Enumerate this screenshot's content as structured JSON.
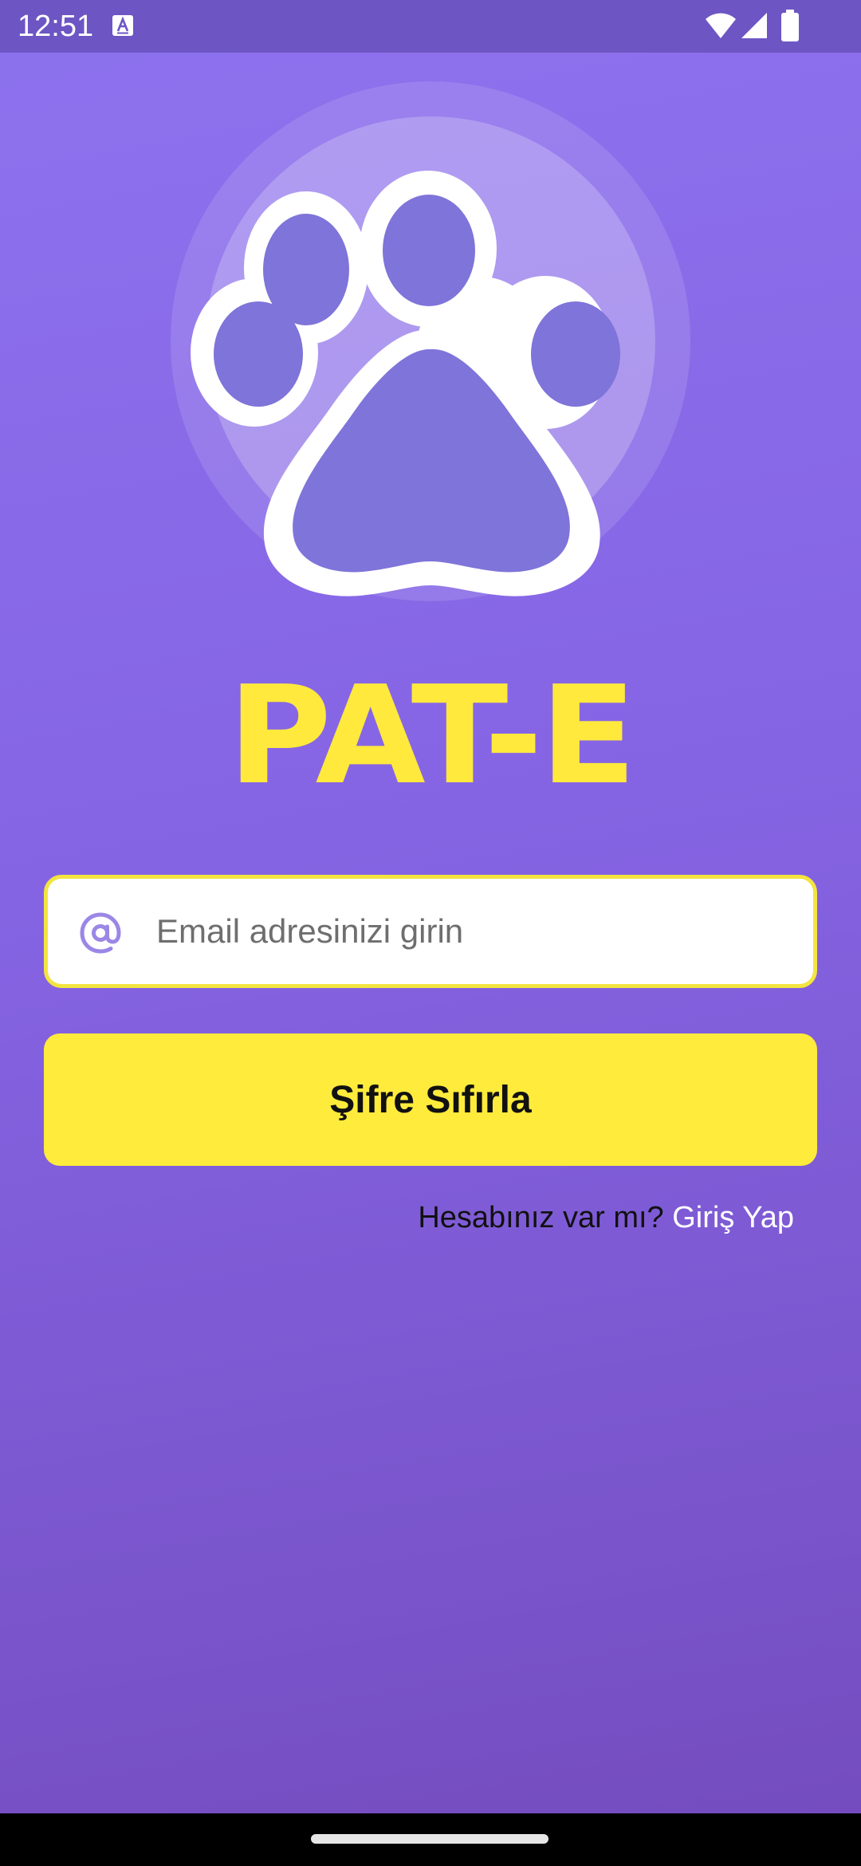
{
  "status_bar": {
    "time": "12:51",
    "notification_icon": "text-format-icon",
    "wifi_icon": "wifi-icon",
    "signal_icon": "cell-signal-icon",
    "battery_icon": "battery-icon"
  },
  "logo": {
    "icon": "paw-icon",
    "title": "PAT-E"
  },
  "email": {
    "icon": "at-sign-icon",
    "placeholder": "Email adresinizi girin",
    "value": ""
  },
  "reset_button": {
    "label": "Şifre Sıfırla"
  },
  "login_prompt": {
    "question": "Hesabınız var mı? ",
    "link": "Giriş Yap"
  },
  "colors": {
    "background_top": "#8d72ee",
    "background_bottom": "#734bbd",
    "accent_yellow": "#ffeb3b",
    "paw_fill": "#7e74d9"
  }
}
